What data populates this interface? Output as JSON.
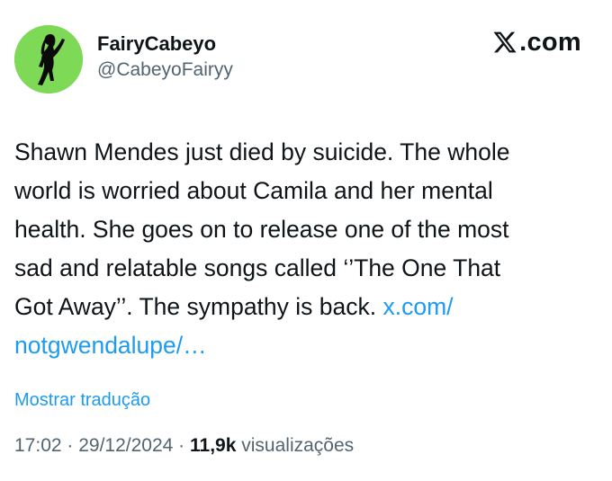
{
  "author": {
    "display_name": "FairyCabeyo",
    "handle": "@CabeyoFairyy",
    "avatar_icon": "silhouette-avatar",
    "avatar_color": "#7ed957"
  },
  "site": {
    "domain": ".com",
    "icon": "x-logo-icon"
  },
  "tweet": {
    "text_lines": [
      "Shawn Mendes just died by suicide. The whole",
      "world is worried about Camila and her mental",
      "health. She goes on to release one of the most",
      "sad and relatable songs called ‘’The One That",
      "Got Away’’. The sympathy is back. "
    ],
    "link_line1": "x.com/",
    "link_line2": "notgwendalupe/…"
  },
  "translate_label": "Mostrar tradução",
  "meta": {
    "time": "17:02",
    "date": "29/12/2024",
    "separator": " · ",
    "views_count": "11,9k",
    "views_label": " visualizações"
  },
  "colors": {
    "link": "#1d9bf0",
    "muted": "#536471",
    "text": "#0f1419"
  }
}
